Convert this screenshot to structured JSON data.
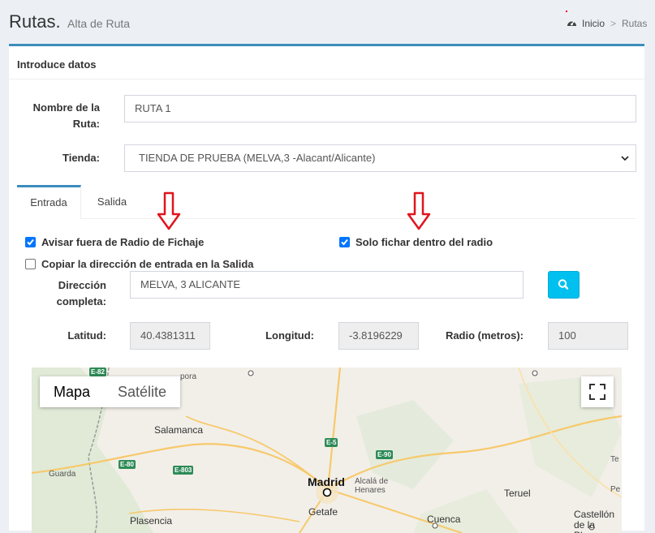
{
  "header": {
    "title": "Rutas.",
    "subtitle": "Alta de Ruta",
    "breadcrumb": [
      "Inicio",
      "Rutas"
    ],
    "breadcrumb_separator": ">"
  },
  "form": {
    "box_title": "Introduce datos",
    "route_name_label_line1": "Nombre de la",
    "route_name_label_line2": "Ruta:",
    "route_name_value": "RUTA 1",
    "store_label": "Tienda:",
    "store_value": "TIENDA DE PRUEBA (MELVA,3 -Alacant/Alicante)"
  },
  "tabs": [
    {
      "label": "Entrada",
      "active": true
    },
    {
      "label": "Salida",
      "active": false
    }
  ],
  "entry": {
    "warn_outside_label": "Avisar fuera de Radio de Fichaje",
    "warn_outside_checked": true,
    "only_inside_label": "Solo fichar dentro del radio",
    "only_inside_checked": true,
    "copy_address_label": "Copiar la dirección de entrada en la Salida",
    "copy_address_checked": false,
    "address_label_line1": "Dirección",
    "address_label_line2": "completa:",
    "address_value": "MELVA, 3 ALICANTE",
    "latitude_label": "Latitud:",
    "latitude_value": "40.4381311",
    "longitude_label": "Longitud:",
    "longitude_value": "-3.8196229",
    "radius_label": "Radio (metros):",
    "radius_value": "100"
  },
  "map": {
    "type_buttons": [
      "Mapa",
      "Satélite"
    ],
    "active_type": "Mapa",
    "places": [
      "Salamanca",
      "Guarda",
      "Madrid",
      "Getafe",
      "Alcalá de Henares",
      "Plasencia",
      "Cuenca",
      "Teruel",
      "Castellón de la Plana",
      "pora",
      "Pe",
      "Te"
    ],
    "roads": [
      "E-82",
      "E-80",
      "E-803",
      "E-5",
      "E-90"
    ]
  },
  "colors": {
    "accent": "#3c8dbc",
    "search_button": "#00c0ef",
    "checkbox": "#0075ff",
    "arrow": "#e0141e"
  }
}
